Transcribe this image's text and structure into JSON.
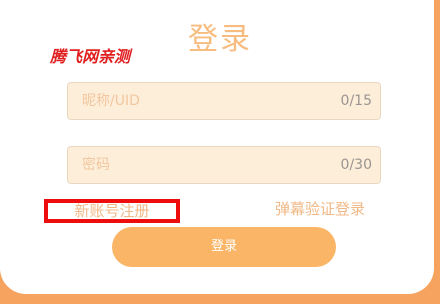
{
  "title": "登录",
  "watermark": "腾飞网亲测",
  "uid_field": {
    "placeholder": "昵称/UID",
    "counter": "0/15"
  },
  "password_field": {
    "placeholder": "密码",
    "counter": "0/30"
  },
  "links": {
    "register": "新账号注册",
    "danmaku_login": "弹幕验证登录"
  },
  "login_button": "登录",
  "colors": {
    "background": "#f6a360",
    "accent": "#f7bd80",
    "button": "#fbb567",
    "highlight_box": "#ee0d0d"
  }
}
